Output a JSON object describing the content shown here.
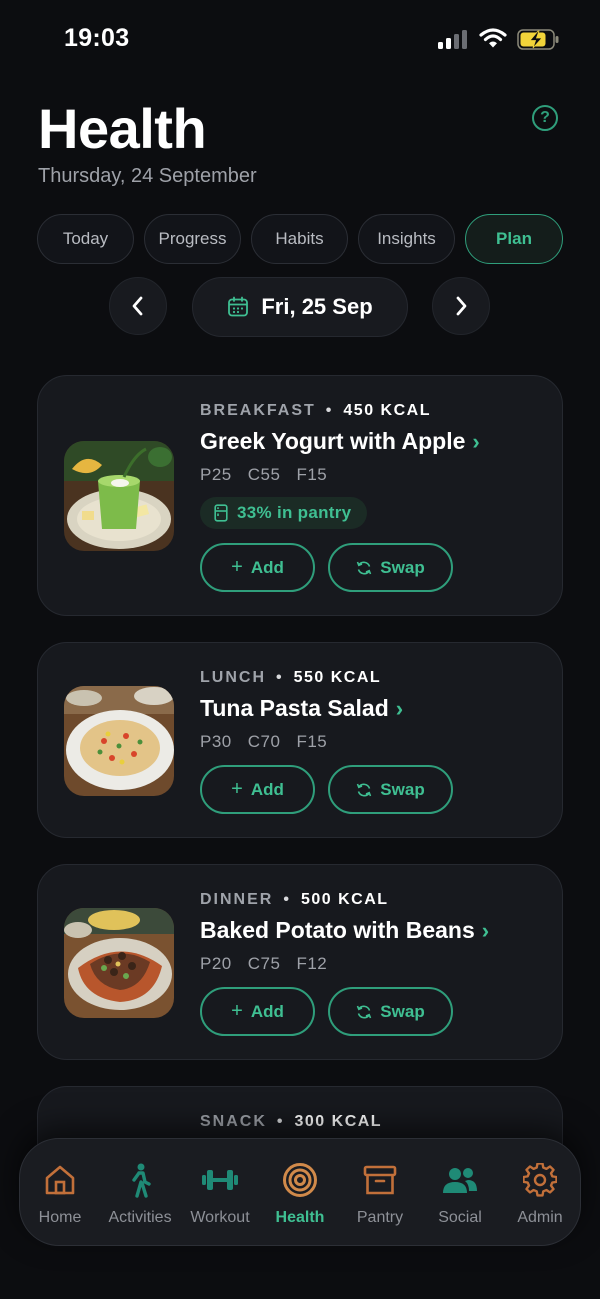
{
  "status_bar": {
    "time": "19:03"
  },
  "header": {
    "title": "Health",
    "date": "Thursday, 24 September",
    "help_icon": "question-circle-icon",
    "help_glyph": "?"
  },
  "tabs": [
    {
      "label": "Today",
      "active": false
    },
    {
      "label": "Progress",
      "active": false
    },
    {
      "label": "Habits",
      "active": false
    },
    {
      "label": "Insights",
      "active": false
    },
    {
      "label": "Plan",
      "active": true
    }
  ],
  "date_nav": {
    "label": "Fri, 25 Sep"
  },
  "meals": [
    {
      "type": "BREAKFAST",
      "kcal": "450 KCAL",
      "name": "Greek Yogurt with Apple",
      "macros": [
        "P25",
        "C55",
        "F15"
      ],
      "pantry": "33% in pantry",
      "add_label": "Add",
      "swap_label": "Swap"
    },
    {
      "type": "LUNCH",
      "kcal": "550 KCAL",
      "name": "Tuna Pasta Salad",
      "macros": [
        "P30",
        "C70",
        "F15"
      ],
      "add_label": "Add",
      "swap_label": "Swap"
    },
    {
      "type": "DINNER",
      "kcal": "500 KCAL",
      "name": "Baked Potato with Beans",
      "macros": [
        "P20",
        "C75",
        "F12"
      ],
      "add_label": "Add",
      "swap_label": "Swap"
    },
    {
      "type": "SNACK",
      "kcal": "300 KCAL"
    }
  ],
  "bottom_nav": [
    {
      "label": "Home",
      "icon": "home-icon",
      "active": false
    },
    {
      "label": "Activities",
      "icon": "walking-person-icon",
      "active": false
    },
    {
      "label": "Workout",
      "icon": "dumbbell-icon",
      "active": false
    },
    {
      "label": "Health",
      "icon": "target-icon",
      "active": true
    },
    {
      "label": "Pantry",
      "icon": "archive-box-icon",
      "active": false
    },
    {
      "label": "Social",
      "icon": "people-icon",
      "active": false
    },
    {
      "label": "Admin",
      "icon": "gear-icon",
      "active": false
    }
  ],
  "colors": {
    "background": "#0c0d10",
    "card": "#17191e",
    "accent": "#3fbf92",
    "accent_border": "#2f9e7b",
    "battery_fill": "#f2d43a"
  }
}
